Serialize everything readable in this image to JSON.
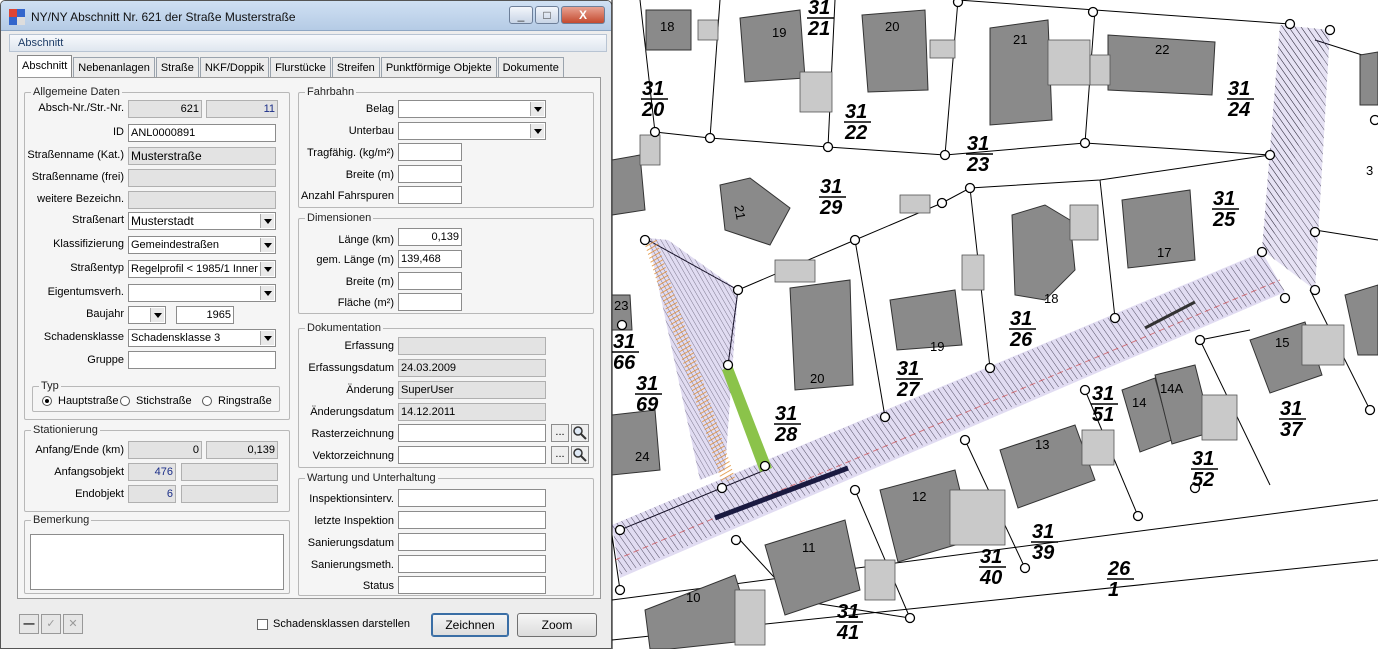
{
  "window": {
    "title": "NY/NY Abschnitt Nr. 621 der Straße",
    "title_street": "Musterstraße",
    "min": "_",
    "max": "□",
    "close": "X"
  },
  "section_header": "Abschnitt",
  "tabs": [
    "Abschnitt",
    "Nebenanlagen",
    "Straße",
    "NKF/Doppik",
    "Flurstücke",
    "Streifen",
    "Punktförmige Objekte",
    "Dokumente"
  ],
  "allg": {
    "title": "Allgemeine Daten",
    "absch_label": "Absch-Nr./Str.-Nr.",
    "absch_nr": "621",
    "str_nr": "11",
    "id_label": "ID",
    "id": "ANL0000891",
    "strname_kat_label": "Straßenname (Kat.)",
    "strname_kat": "Musterstraße",
    "strname_frei_label": "Straßenname (frei)",
    "strname_frei": "",
    "weitere_label": "weitere Bezeichn.",
    "weitere": "",
    "strassenart_label": "Straßenart",
    "strassenart": "Musterstadt",
    "klass_label": "Klassifizierung",
    "klass": "Gemeindestraßen",
    "strtyp_label": "Straßentyp",
    "strtyp": "Regelprofil < 1985/1 Inner",
    "eigentum_label": "Eigentumsverh.",
    "eigentum": "",
    "baujahr_label": "Baujahr",
    "baujahr_sel": "",
    "baujahr": "1965",
    "schaden_label": "Schadensklasse",
    "schaden": "Schadensklasse 3",
    "gruppe_label": "Gruppe",
    "gruppe": ""
  },
  "typ": {
    "title": "Typ",
    "options": [
      "Hauptstraße",
      "Stichstraße",
      "Ringstraße"
    ],
    "selected": 0
  },
  "station": {
    "title": "Stationierung",
    "anfang_label": "Anfang/Ende (km)",
    "anfang": "0",
    "ende": "0,139",
    "aobj_label": "Anfangsobjekt",
    "aobj": "476",
    "aobj2": "",
    "eobj_label": "Endobjekt",
    "eobj": "6",
    "eobj2": ""
  },
  "bemerkung": {
    "title": "Bemerkung",
    "text": ""
  },
  "fahrbahn": {
    "title": "Fahrbahn",
    "belag_label": "Belag",
    "belag": "",
    "unterbau_label": "Unterbau",
    "unterbau": "",
    "trag_label": "Tragfähig. (kg/m²)",
    "trag": "",
    "breite_label": "Breite (m)",
    "breite": "",
    "spuren_label": "Anzahl Fahrspuren",
    "spuren": ""
  },
  "dimensionen": {
    "title": "Dimensionen",
    "laenge_label": "Länge (km)",
    "laenge": "0,139",
    "gem_label": "gem. Länge (m)",
    "gem": "139,468",
    "breite_label": "Breite (m)",
    "breite": "",
    "flaeche_label": "Fläche (m²)",
    "flaeche": ""
  },
  "doku": {
    "title": "Dokumentation",
    "erf_label": "Erfassung",
    "erf": "",
    "erfdat_label": "Erfassungsdatum",
    "erfdat": "24.03.2009",
    "aend_label": "Änderung",
    "aend": "SuperUser",
    "aenddat_label": "Änderungsdatum",
    "aenddat": "14.12.2011",
    "raster_label": "Rasterzeichnung",
    "raster": "",
    "vektor_label": "Vektorzeichnung",
    "vektor": "",
    "dots": "..."
  },
  "wartung": {
    "title": "Wartung und Unterhaltung",
    "insp_label": "Inspektionsinterv.",
    "insp": "",
    "letzte_label": "letzte Inspektion",
    "letzte": "",
    "sandat_label": "Sanierungsdatum",
    "sandat": "",
    "sanmeth_label": "Sanierungsmeth.",
    "sanmeth": "",
    "status_label": "Status",
    "status": ""
  },
  "footer": {
    "checkbox_label": "Schadensklassen darstellen",
    "zeichnen": "Zeichnen",
    "zoom": "Zoom",
    "tool_minus": "—",
    "tool_check": "✓",
    "tool_x": "✕"
  },
  "map": {
    "parcels": [
      {
        "n": "31",
        "d": "21"
      },
      {
        "n": "31",
        "d": "20"
      },
      {
        "n": "31",
        "d": "22"
      },
      {
        "n": "31",
        "d": "24"
      },
      {
        "n": "31",
        "d": "23"
      },
      {
        "n": "31",
        "d": "29"
      },
      {
        "n": "31",
        "d": "25"
      },
      {
        "n": "31",
        "d": "26"
      },
      {
        "n": "31",
        "d": "27"
      },
      {
        "n": "31",
        "d": "28"
      },
      {
        "n": "31",
        "d": "66"
      },
      {
        "n": "31",
        "d": "69"
      },
      {
        "n": "31",
        "d": "51"
      },
      {
        "n": "31",
        "d": "52"
      },
      {
        "n": "31",
        "d": "37"
      },
      {
        "n": "31",
        "d": "39"
      },
      {
        "n": "31",
        "d": "40"
      },
      {
        "n": "31",
        "d": "41"
      },
      {
        "n": "26",
        "d": "1"
      }
    ],
    "houses": [
      "18",
      "19",
      "20",
      "21",
      "22",
      "21",
      "17",
      "18",
      "19",
      "20",
      "15",
      "14",
      "14A",
      "13",
      "12",
      "11",
      "10",
      "24",
      "23",
      "3"
    ]
  }
}
